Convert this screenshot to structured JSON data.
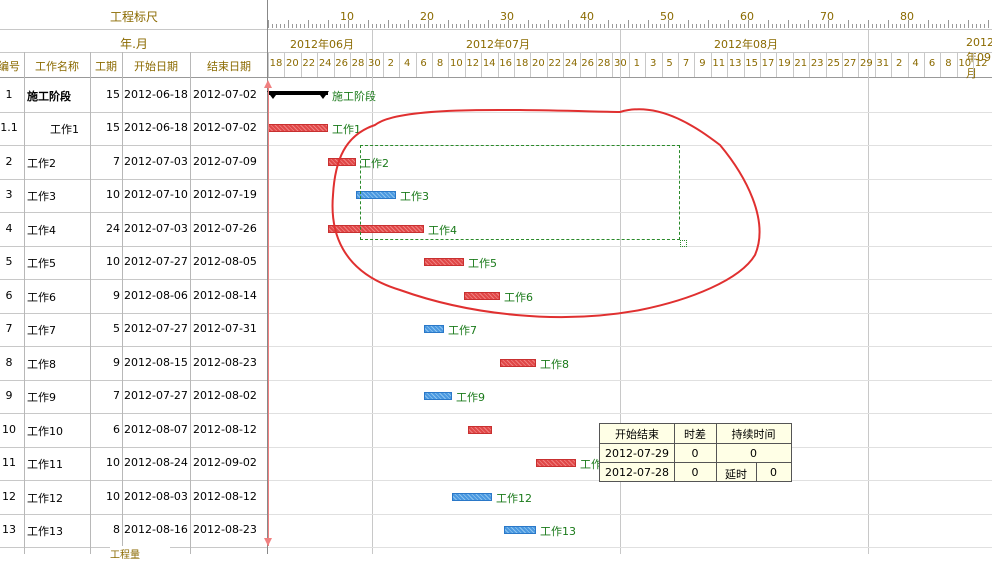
{
  "header": {
    "scale_title": "工程标尺",
    "ym_title": "年.月",
    "col_id": "编号",
    "col_name": "工作名称",
    "col_dur": "工期",
    "col_start": "开始日期",
    "col_end": "结束日期",
    "footer_hint": "工程量"
  },
  "scale": {
    "numbers": [
      "10",
      "20",
      "30",
      "40",
      "50",
      "60",
      "70",
      "80"
    ]
  },
  "months": [
    "2012年06月",
    "2012年07月",
    "2012年08月",
    "2012年09月"
  ],
  "days": [
    "18",
    "20",
    "22",
    "24",
    "26",
    "28",
    "30",
    "2",
    "4",
    "6",
    "8",
    "10",
    "12",
    "14",
    "16",
    "18",
    "20",
    "22",
    "24",
    "26",
    "28",
    "30",
    "1",
    "3",
    "5",
    "7",
    "9",
    "11",
    "13",
    "15",
    "17",
    "19",
    "21",
    "23",
    "25",
    "27",
    "29",
    "31",
    "2",
    "4",
    "6",
    "8",
    "10",
    "12"
  ],
  "rows": [
    {
      "id": "1",
      "name": "施工阶段",
      "dur": "15",
      "start": "2012-06-18",
      "end": "2012-07-02",
      "label": "施工阶段",
      "summary": true
    },
    {
      "id": "1.1",
      "name": "工作1",
      "dur": "15",
      "start": "2012-06-18",
      "end": "2012-07-02",
      "label": "工作1",
      "color": "red"
    },
    {
      "id": "2",
      "name": "工作2",
      "dur": "7",
      "start": "2012-07-03",
      "end": "2012-07-09",
      "label": "工作2",
      "color": "red"
    },
    {
      "id": "3",
      "name": "工作3",
      "dur": "10",
      "start": "2012-07-10",
      "end": "2012-07-19",
      "label": "工作3",
      "color": "blue"
    },
    {
      "id": "4",
      "name": "工作4",
      "dur": "24",
      "start": "2012-07-03",
      "end": "2012-07-26",
      "label": "工作4",
      "color": "red"
    },
    {
      "id": "5",
      "name": "工作5",
      "dur": "10",
      "start": "2012-07-27",
      "end": "2012-08-05",
      "label": "工作5",
      "color": "red"
    },
    {
      "id": "6",
      "name": "工作6",
      "dur": "9",
      "start": "2012-08-06",
      "end": "2012-08-14",
      "label": "工作6",
      "color": "red"
    },
    {
      "id": "7",
      "name": "工作7",
      "dur": "5",
      "start": "2012-07-27",
      "end": "2012-07-31",
      "label": "工作7",
      "color": "blue"
    },
    {
      "id": "8",
      "name": "工作8",
      "dur": "9",
      "start": "2012-08-15",
      "end": "2012-08-23",
      "label": "工作8",
      "color": "red"
    },
    {
      "id": "9",
      "name": "工作9",
      "dur": "7",
      "start": "2012-07-27",
      "end": "2012-08-02",
      "label": "工作9",
      "color": "blue"
    },
    {
      "id": "10",
      "name": "工作10",
      "dur": "6",
      "start": "2012-08-07",
      "end": "2012-08-12",
      "label": "",
      "color": "red"
    },
    {
      "id": "11",
      "name": "工作11",
      "dur": "10",
      "start": "2012-08-24",
      "end": "2012-09-02",
      "label": "工作11",
      "color": "red"
    },
    {
      "id": "12",
      "name": "工作12",
      "dur": "10",
      "start": "2012-08-03",
      "end": "2012-08-12",
      "label": "工作12",
      "color": "blue"
    },
    {
      "id": "13",
      "name": "工作13",
      "dur": "8",
      "start": "2012-08-16",
      "end": "2012-08-23",
      "label": "工作13",
      "color": "blue"
    }
  ],
  "popup": {
    "h_startend": "开始结束",
    "h_slack": "时差",
    "h_duration": "持续时间",
    "r1_date": "2012-07-29",
    "r1_slack": "0",
    "r1_dur": "0",
    "r2_date": "2012-07-28",
    "r2_slack": "0",
    "r2_delay_label": "延时",
    "r2_delay": "0"
  },
  "colors": {
    "red": "#e04848",
    "blue": "#4a98e0",
    "label_green": "#1a7a1a",
    "header_gold": "#8b6a00",
    "annotation": "#e03030"
  }
}
